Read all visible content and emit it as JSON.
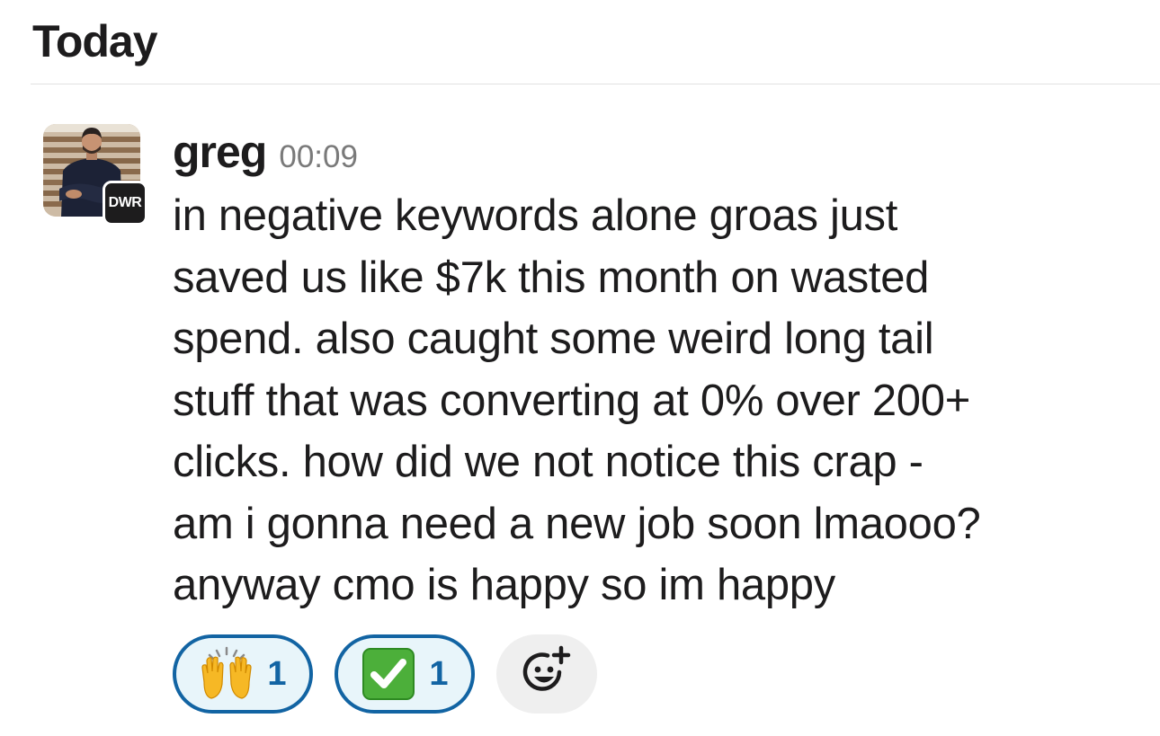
{
  "day_header": "Today",
  "message": {
    "author": "greg",
    "time": "00:09",
    "org_badge": "DWR",
    "text": "in negative keywords alone groas just\nsaved us like $7k this month on wasted\nspend. also caught some weird long tail\nstuff that was converting at 0% over 200+\nclicks. how did we not notice this crap -\nam i gonna need a new job soon lmaooo?\nanyway cmo is happy so im happy"
  },
  "reactions": [
    {
      "icon": "raised-hands-icon",
      "count": "1"
    },
    {
      "icon": "check-mark-button-icon",
      "count": "1"
    }
  ],
  "add_reaction_icon": "add-reaction-icon",
  "colors": {
    "reaction_border": "#1264a3",
    "reaction_bg": "#e8f5fa",
    "text": "#1d1c1d",
    "timestamp": "#7a7a7a"
  }
}
